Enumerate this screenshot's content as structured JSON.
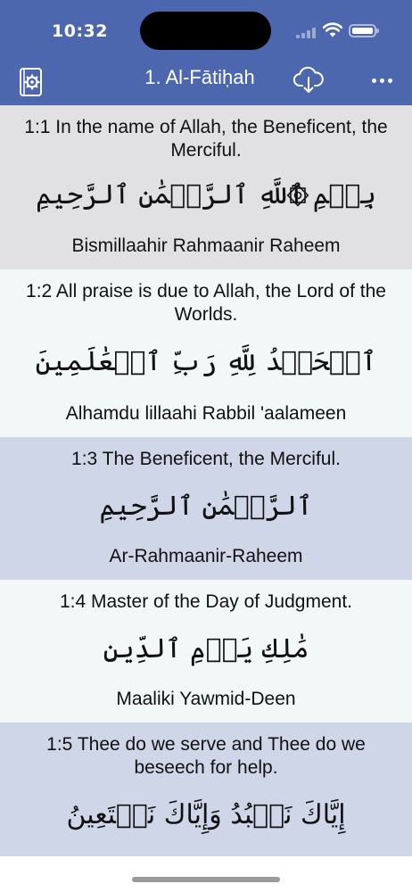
{
  "status_bar": {
    "time": "10:32"
  },
  "nav": {
    "title": "1. Al-Fātiḥah",
    "icons": {
      "settings": "gear-book-icon",
      "cloud": "cloud-download-icon",
      "more": "more-horizontal-icon"
    }
  },
  "verses": [
    {
      "translation": "1:1 In the name of Allah, the Beneficent, the Merciful.",
      "arabic": "بِسۡمِ ٱللَّهِ ٱلرَّحۡمَٰنِ ٱلرَّحِيمِ",
      "transliteration": "Bismillaahir Rahmaanir Raheem"
    },
    {
      "translation": "1:2 All praise is due to Allah, the Lord of the Worlds.",
      "arabic": "ٱلۡحَمۡدُ لِلَّهِ رَبِّ ٱلۡعَٰلَمِينَ",
      "transliteration": "Alhamdu lillaahi Rabbil 'aalameen"
    },
    {
      "translation": "1:3 The Beneficent, the Merciful.",
      "arabic": "ٱلرَّحۡمَٰنِ ٱلرَّحِيمِ",
      "transliteration": "Ar-Rahmaanir-Raheem"
    },
    {
      "translation": "1:4 Master of the Day of Judgment.",
      "arabic": "مَٰلِكِ يَوۡمِ ٱلدِّينِ",
      "transliteration": "Maaliki Yawmid-Deen"
    },
    {
      "translation": "1:5 Thee do we serve and Thee do we beseech for help.",
      "arabic": "إِيَّاكَ نَعۡبُدُ وَإِيَّاكَ نَسۡتَعِينُ",
      "transliteration": ""
    }
  ],
  "colors": {
    "header": "#4c67ad",
    "verse_gray": "#e1e1e4",
    "verse_light": "#f2f7f8",
    "verse_blue": "#cfd6e8"
  }
}
